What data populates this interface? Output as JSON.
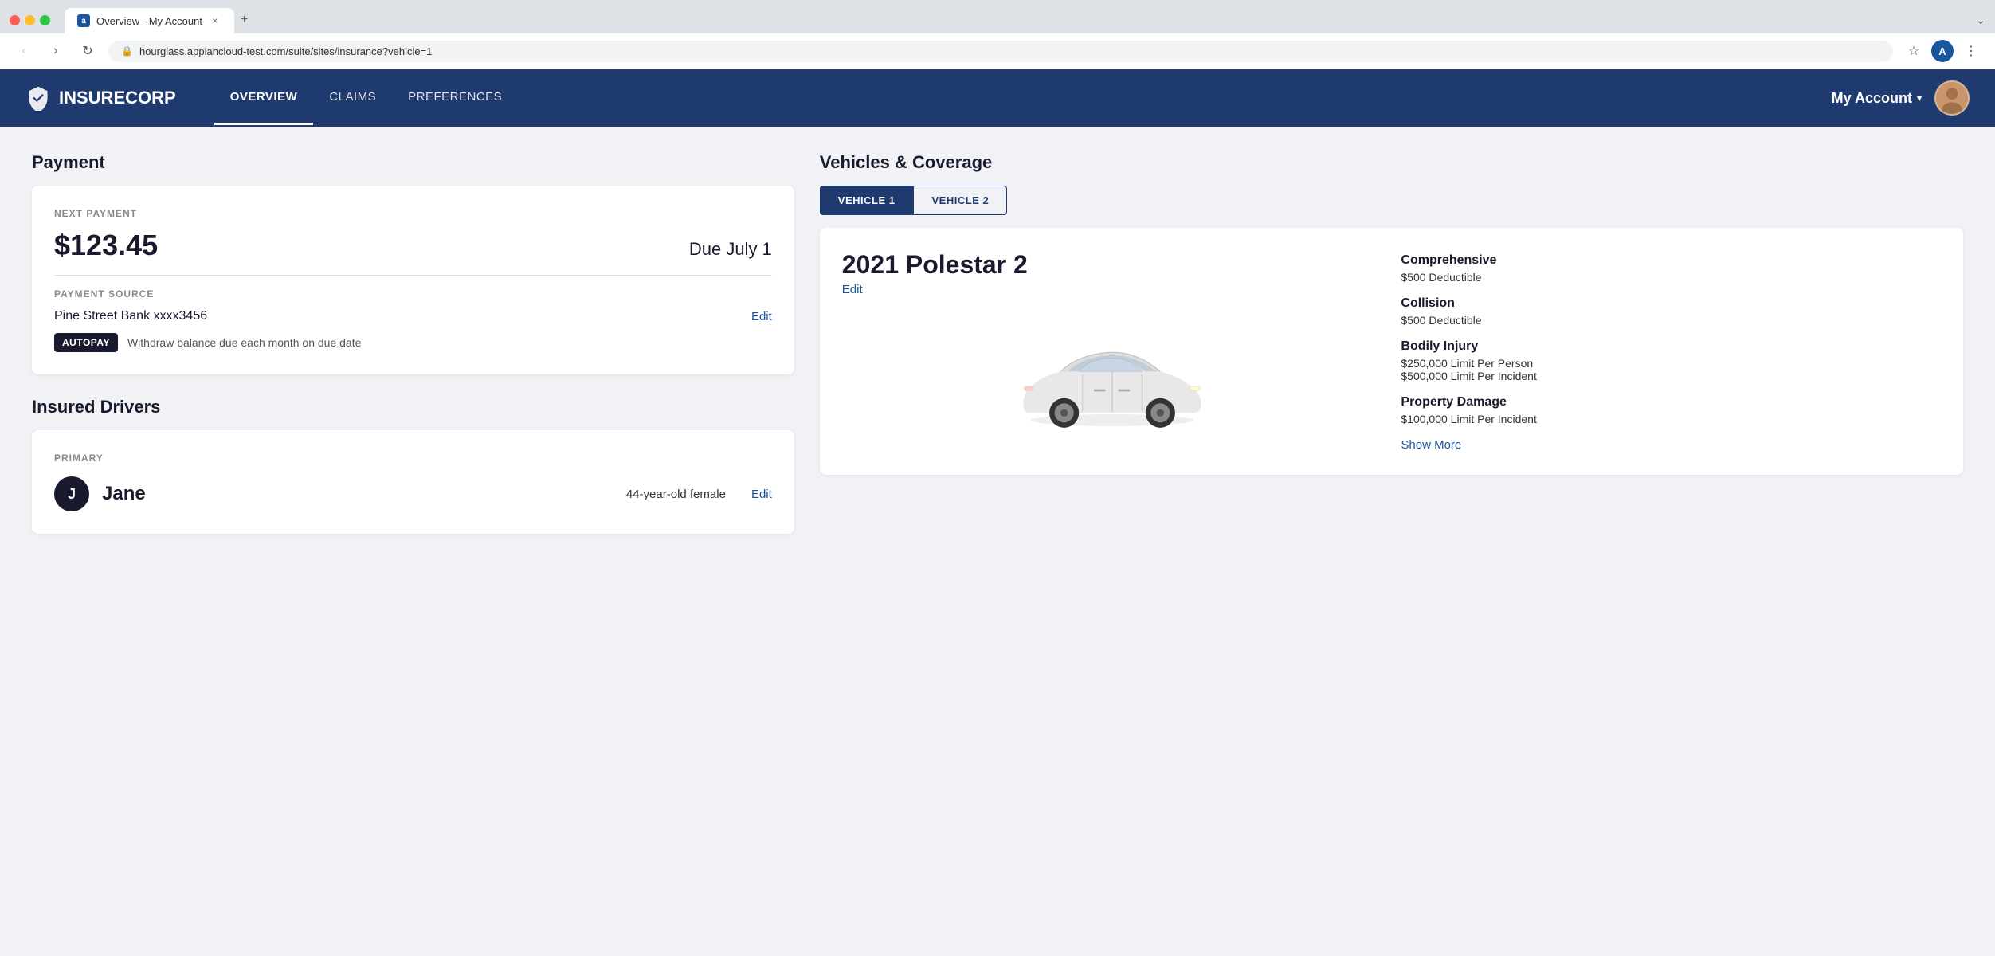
{
  "browser": {
    "tab_label": "Overview - My Account",
    "tab_icon": "a",
    "url": "hourglass.appiancloud-test.com/suite/sites/insurance?vehicle=1",
    "new_tab": "+",
    "expand_icon": "⌄"
  },
  "header": {
    "logo_name": "INSURECORP",
    "nav": {
      "overview": "OVERVIEW",
      "claims": "CLAIMS",
      "preferences": "PREFERENCES"
    },
    "my_account": "My Account",
    "my_account_dropdown": "▾"
  },
  "payment": {
    "section_title": "Payment",
    "next_payment_label": "NEXT PAYMENT",
    "amount": "$123.45",
    "due_date": "Due July 1",
    "source_label": "PAYMENT SOURCE",
    "source_name": "Pine Street Bank xxxx3456",
    "edit_source": "Edit",
    "autopay_badge": "AUTOPAY",
    "autopay_description": "Withdraw balance due each month on due date"
  },
  "drivers": {
    "section_title": "Insured Drivers",
    "primary_label": "PRIMARY",
    "driver": {
      "initial": "J",
      "name": "Jane",
      "description": "44-year-old female",
      "edit": "Edit"
    }
  },
  "vehicles": {
    "section_title": "Vehicles & Coverage",
    "tabs": [
      {
        "label": "VEHICLE 1",
        "active": true
      },
      {
        "label": "VEHICLE 2",
        "active": false
      }
    ],
    "vehicle1": {
      "name": "2021 Polestar 2",
      "edit": "Edit",
      "coverage": [
        {
          "name": "Comprehensive",
          "details": [
            "$500 Deductible"
          ]
        },
        {
          "name": "Collision",
          "details": [
            "$500 Deductible"
          ]
        },
        {
          "name": "Bodily Injury",
          "details": [
            "$250,000 Limit Per Person",
            "$500,000 Limit Per Incident"
          ]
        },
        {
          "name": "Property Damage",
          "details": [
            "$100,000 Limit Per Incident"
          ]
        }
      ],
      "show_more": "Show More"
    }
  }
}
